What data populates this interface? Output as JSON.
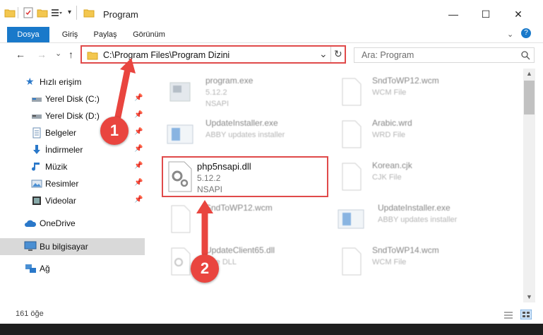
{
  "window": {
    "title": "Program",
    "minimize": "—",
    "maximize": "☐",
    "close": "✕"
  },
  "ribbon": {
    "tabs": [
      "Dosya",
      "Giriş",
      "Paylaş",
      "Görünüm"
    ]
  },
  "nav": {
    "back": "←",
    "forward": "→",
    "dropdown": "⌄",
    "up": "↑",
    "address": "C:\\Program Files\\Program Dizini",
    "address_dropdown": "⌄",
    "refresh": "↻",
    "search_placeholder": "Ara: Program"
  },
  "sidebar": {
    "quick_access": "Hızlı erişim",
    "items": [
      {
        "label": "Yerel Disk (C:)",
        "icon": "drive-icon",
        "pinned": true
      },
      {
        "label": "Yerel Disk (D:)",
        "icon": "drive-icon",
        "pinned": true
      },
      {
        "label": "Belgeler",
        "icon": "documents-icon",
        "pinned": true
      },
      {
        "label": "İndirmeler",
        "icon": "downloads-icon",
        "pinned": true
      },
      {
        "label": "Müzik",
        "icon": "music-icon",
        "pinned": true
      },
      {
        "label": "Resimler",
        "icon": "pictures-icon",
        "pinned": true
      },
      {
        "label": "Videolar",
        "icon": "videos-icon",
        "pinned": true
      }
    ],
    "onedrive": "OneDrive",
    "this_pc": "Bu bilgisayar",
    "network": "Ağ"
  },
  "files_left": [
    {
      "name": "program.exe",
      "version": "5.12.2",
      "desc": "NSAPI"
    },
    {
      "name": "UpdateInstaller.exe",
      "version": "",
      "desc": "ABBY updates installer"
    },
    {
      "name": "php5nsapi.dll",
      "version": "5.12.2",
      "desc": "NSAPI"
    },
    {
      "name": "SndToWP12.wcm",
      "version": "",
      "desc": ""
    },
    {
      "name": "UpdateClient65.dll",
      "version": "",
      "desc": "...ce DLL"
    }
  ],
  "files_right": [
    {
      "name": "SndToWP12.wcm",
      "desc": "WCM File"
    },
    {
      "name": "Arabic.wrd",
      "desc": "WRD File"
    },
    {
      "name": "Korean.cjk",
      "desc": "CJK File"
    },
    {
      "name": "UpdateInstaller.exe",
      "desc": "ABBY updates installer"
    },
    {
      "name": "SndToWP14.wcm",
      "desc": "WCM File"
    }
  ],
  "callouts": {
    "one": "1",
    "two": "2"
  },
  "status": {
    "count": "161 öğe"
  },
  "colors": {
    "accent": "#1979ca",
    "highlight": "#e04a4a",
    "badge": "#e9453f"
  }
}
